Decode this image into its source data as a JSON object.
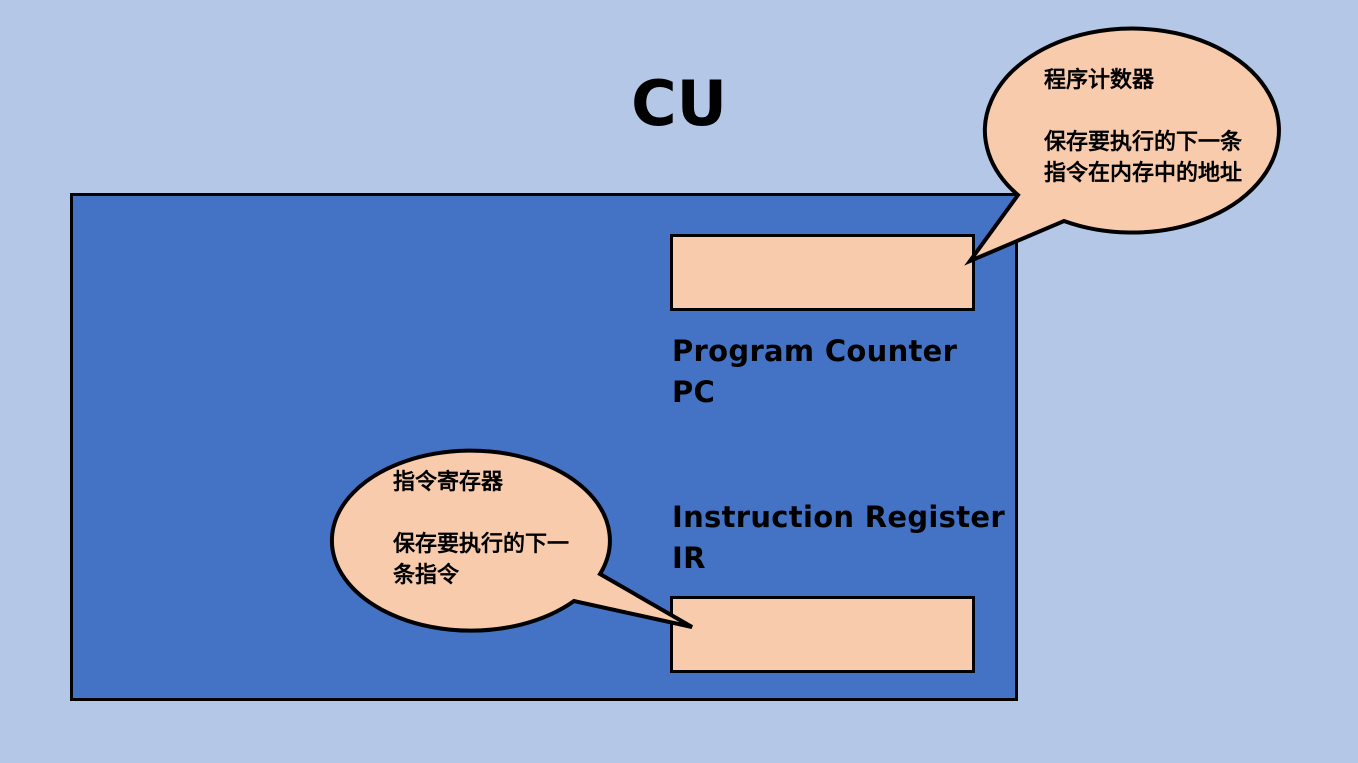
{
  "diagram": {
    "title": "CU",
    "program_counter": {
      "label_line1": "Program Counter",
      "label_line2": "PC",
      "callout": {
        "heading": "程序计数器",
        "line1": "保存要执行的下一条",
        "line2": "指令在内存中的地址"
      }
    },
    "instruction_register": {
      "label_line1": "Instruction Register",
      "label_line2": "IR",
      "callout": {
        "heading": "指令寄存器",
        "line1": "保存要执行的下一",
        "line2": "条指令"
      }
    },
    "colors": {
      "background": "#b4c7e7",
      "cu_fill": "#4472c4",
      "register_fill": "#f8cbad",
      "outline": "#000000"
    }
  }
}
